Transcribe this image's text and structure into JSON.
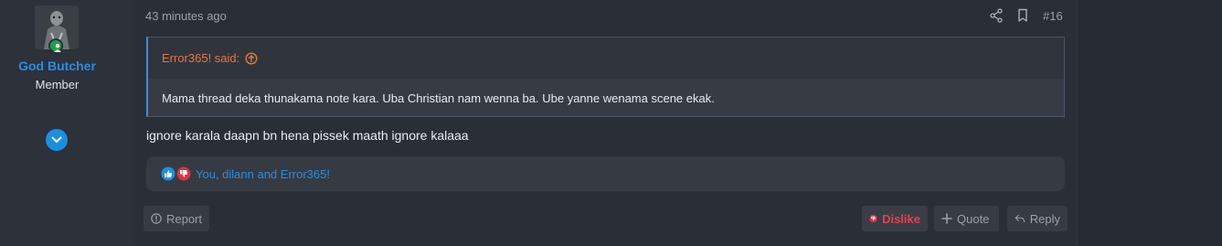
{
  "user": {
    "name": "God Butcher",
    "title": "Member",
    "status": "online",
    "avatar_icon": "avatar-image",
    "online_icon": "online-status-icon",
    "expand_icon": "chevron-down-icon"
  },
  "post": {
    "time": "43 minutes ago",
    "number": "#16",
    "header_icons": [
      "share-icon",
      "bookmark-icon"
    ],
    "quote": {
      "author_said": "Error365! said:",
      "jump_icon": "arrow-up-circle-icon",
      "text": "Mama thread deka thunakama note kara. Uba Christian nam wenna ba. Ube yanne wenama scene ekak."
    },
    "message": "ignore karala daapn bn hena pissek maath ignore kalaaa",
    "reactions": {
      "icons": [
        "like-icon",
        "dislike-icon"
      ],
      "reacted_by": "You, dilann and Error365!"
    },
    "actions": {
      "report": "Report",
      "dislike": "Dislike",
      "quote": "Quote",
      "reply": "Reply"
    }
  },
  "colors": {
    "background": "#2a2e36",
    "accent": "#2a8de0",
    "quote_author": "#e8763a",
    "dislike": "#e8404c",
    "online": "#22a04b"
  }
}
